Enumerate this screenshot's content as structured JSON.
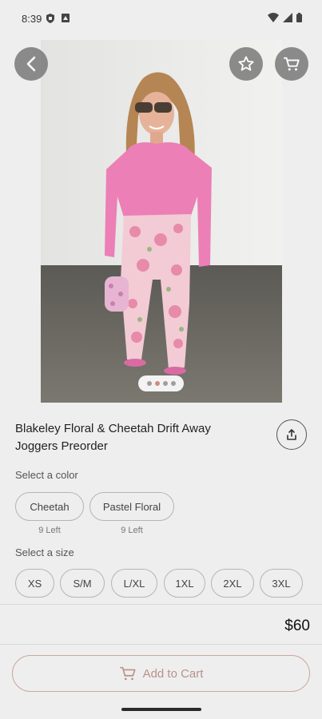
{
  "status_bar": {
    "time": "8:39"
  },
  "product": {
    "title": "Blakeley Floral & Cheetah Drift Away Joggers Preorder",
    "image_count": 4,
    "active_image": 1,
    "price": "$60"
  },
  "color": {
    "label": "Select a color",
    "options": [
      {
        "name": "Cheetah",
        "stock": "9 Left"
      },
      {
        "name": "Pastel Floral",
        "stock": "9 Left"
      }
    ]
  },
  "size": {
    "label": "Select a size",
    "options": [
      "XS",
      "S/M",
      "L/XL",
      "1XL",
      "2XL",
      "3XL"
    ]
  },
  "actions": {
    "add_to_cart": "Add to Cart"
  },
  "icons": {
    "back": "chevron-left-icon",
    "favorite": "star-icon",
    "cart": "cart-icon",
    "share": "share-icon"
  },
  "colors": {
    "accent": "#b8918a",
    "dot_active": "#cf8d7b",
    "shirt": "#ec7fb6"
  }
}
